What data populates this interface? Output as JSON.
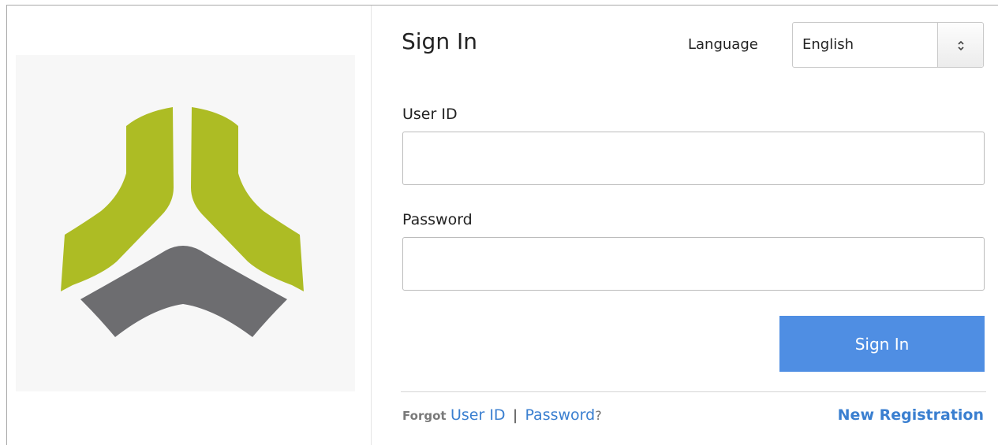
{
  "form": {
    "title": "Sign In",
    "language_label": "Language",
    "language_value": "English",
    "user_id_label": "User ID",
    "user_id_value": "",
    "password_label": "Password",
    "password_value": "",
    "submit_label": "Sign In"
  },
  "footer": {
    "forgot_text": "Forgot",
    "user_id_link": "User ID",
    "separator": "|",
    "password_link": "Password",
    "question_mark": "?",
    "new_registration_link": "New Registration"
  },
  "colors": {
    "logo_green": "#adbc24",
    "logo_gray": "#6d6d70",
    "button_blue": "#4f8ee3",
    "link_blue": "#3a7fd0"
  },
  "icons": {
    "logo": "tri-segment-logo",
    "select_arrows": "up-down-chevron-icon"
  }
}
